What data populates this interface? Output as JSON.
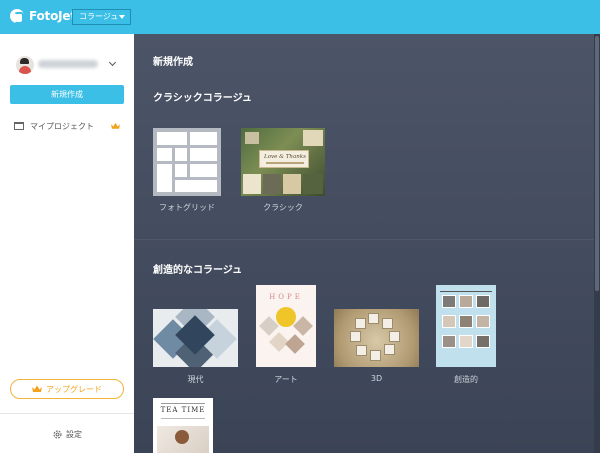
{
  "app": {
    "name": "FotoJet",
    "mode": "コラージュ"
  },
  "sidebar": {
    "new_button": "新規作成",
    "my_projects": "マイプロジェクト",
    "upgrade": "アップグレード",
    "settings": "設定"
  },
  "main": {
    "heading_new": "新規作成",
    "section_classic": {
      "title": "クラシックコラージュ",
      "items": [
        {
          "label": "フォトグリッド"
        },
        {
          "label": "クラシック",
          "thumb_text": "Love & Thanks"
        }
      ]
    },
    "section_creative": {
      "title": "創造的なコラージュ",
      "items": [
        {
          "label": "現代"
        },
        {
          "label": "アート",
          "thumb_text": "HOPE"
        },
        {
          "label": "3D"
        },
        {
          "label": "創造的"
        },
        {
          "label": "",
          "thumb_text": "TEA TIME"
        }
      ]
    }
  },
  "colors": {
    "accent": "#3bbfe6",
    "upgrade": "#f2a31b",
    "main_bg": "#3f4a5a"
  },
  "icons": [
    "logo-icon",
    "chevron-down-icon",
    "folder-icon",
    "crown-icon",
    "gear-icon"
  ]
}
